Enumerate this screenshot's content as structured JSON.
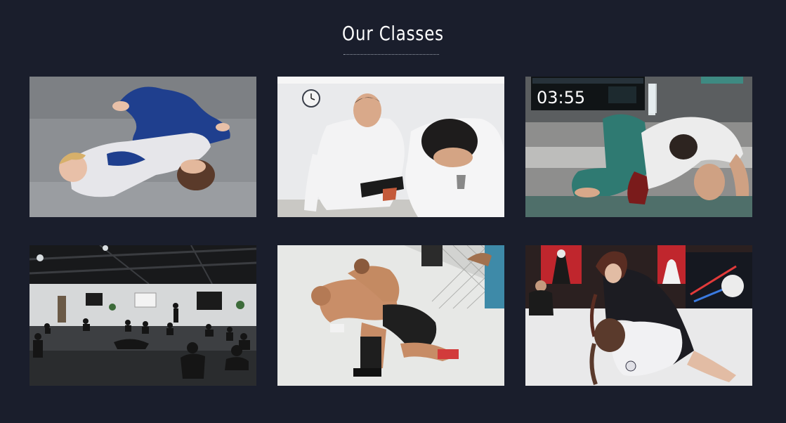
{
  "section": {
    "title": "Our Classes"
  },
  "classes": [
    {
      "image": "kids-grappling-photo"
    },
    {
      "image": "adult-gi-drilling-photo"
    },
    {
      "image": "competition-match-photo"
    },
    {
      "image": "open-mat-gym-photo"
    },
    {
      "image": "mma-cage-fight-photo"
    },
    {
      "image": "womens-jiujitsu-photo"
    }
  ],
  "scoreboard": {
    "time": "03:55"
  },
  "colors": {
    "background": "#1a1e2c",
    "title": "#ffffff",
    "underline": "#9aa0ad"
  }
}
